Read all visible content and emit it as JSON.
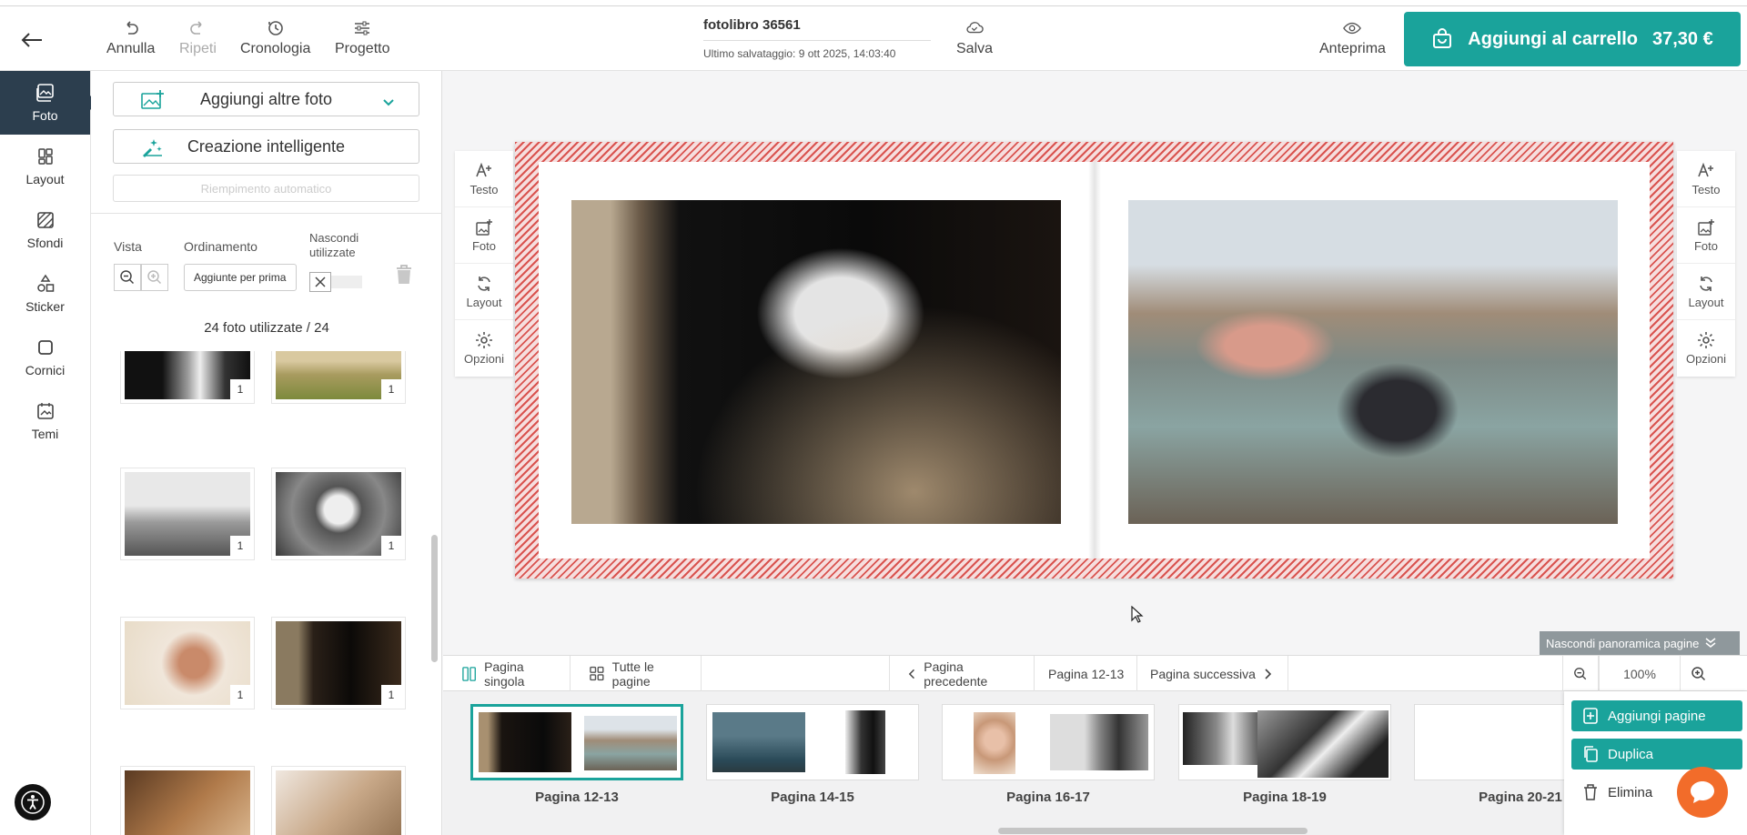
{
  "toolbar": {
    "undo": "Annulla",
    "redo": "Ripeti",
    "history": "Cronologia",
    "project": "Progetto",
    "doc_name": "fotolibro 36561",
    "last_saved": "Ultimo salvataggio:  9 ott 2025, 14:03:40",
    "save": "Salva",
    "preview": "Anteprima",
    "cart_label": "Aggiungi al carrello",
    "cart_price": "37,30 €"
  },
  "rail": {
    "items": [
      {
        "label": "Foto"
      },
      {
        "label": "Layout"
      },
      {
        "label": "Sfondi"
      },
      {
        "label": "Sticker"
      },
      {
        "label": "Cornici"
      },
      {
        "label": "Temi"
      }
    ]
  },
  "panel": {
    "add_photos": "Aggiungi altre foto",
    "smart_create": "Creazione intelligente",
    "autofill": "Riempimento automatico",
    "view_label": "Vista",
    "sort_label": "Ordinamento",
    "sort_value": "Aggiunte per prima",
    "hide_used_label": "Nascondi utilizzate",
    "used_count": "24 foto utilizzate / 24",
    "thumb_count": "1"
  },
  "canvas_tools": {
    "text": "Testo",
    "photo": "Foto",
    "layout": "Layout",
    "options": "Opzioni"
  },
  "bottom": {
    "single_page": "Pagina singola",
    "all_pages": "Tutte le pagine",
    "prev_page": "Pagina precedente",
    "current": "Pagina 12-13",
    "next_page": "Pagina successiva",
    "zoom": "100%",
    "hide_overview": "Nascondi panoramica pagine",
    "spreads": [
      "Pagina 12-13",
      "Pagina 14-15",
      "Pagina 16-17",
      "Pagina 18-19",
      "Pagina 20-21"
    ]
  },
  "actions": {
    "add_pages": "Aggiungi pagine",
    "duplicate": "Duplica",
    "delete": "Elimina"
  },
  "colors": {
    "accent": "#1aa39b",
    "rail_active": "#2c3e4e",
    "bleed_stripe": "#d9534f",
    "chat": "#f26c2a"
  }
}
